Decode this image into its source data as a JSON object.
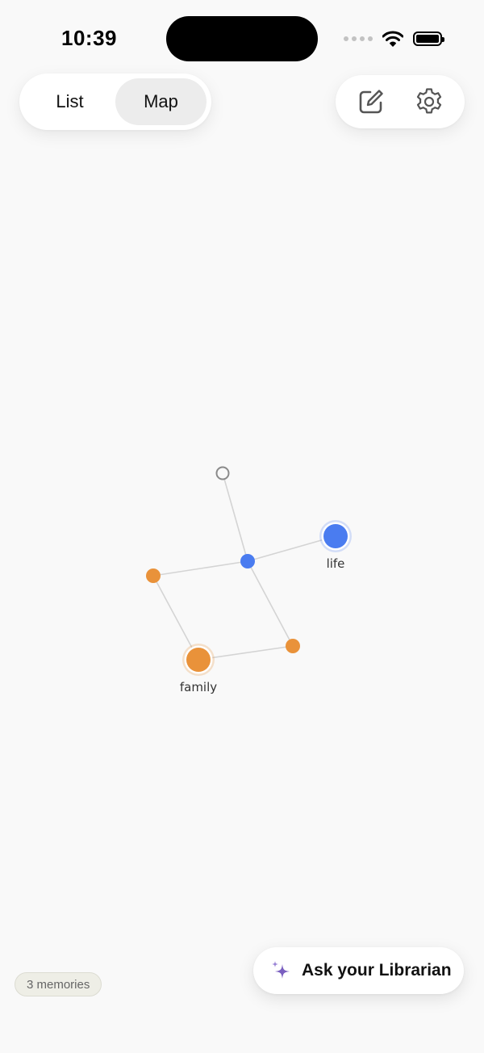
{
  "status_bar": {
    "time": "10:39"
  },
  "view_switcher": {
    "list_label": "List",
    "map_label": "Map",
    "selected": "Map"
  },
  "toolbar": {
    "compose_icon": "square-pencil-icon",
    "settings_icon": "gear-icon"
  },
  "graph": {
    "nodes": [
      {
        "id": "hollow",
        "label": "",
        "kind": "hollow"
      },
      {
        "id": "hub",
        "label": "",
        "kind": "small-blue"
      },
      {
        "id": "life",
        "label": "life",
        "kind": "tag-blue"
      },
      {
        "id": "orange-left",
        "label": "",
        "kind": "small-orange"
      },
      {
        "id": "orange-right",
        "label": "",
        "kind": "small-orange"
      },
      {
        "id": "family",
        "label": "family",
        "kind": "tag-orange"
      }
    ],
    "edges": [
      [
        "hollow",
        "hub"
      ],
      [
        "hub",
        "life"
      ],
      [
        "hub",
        "orange-left"
      ],
      [
        "hub",
        "orange-right"
      ],
      [
        "orange-left",
        "family"
      ],
      [
        "family",
        "orange-right"
      ]
    ],
    "colors": {
      "blue": "#4a7cf0",
      "orange": "#e9923a",
      "edge": "#d4d4d4",
      "hollow_stroke": "#8a8a8a"
    }
  },
  "footer": {
    "memories_count": "3 memories",
    "ask_label": "Ask your Librarian",
    "ask_icon": "sparkles-icon",
    "accent": "#7a5fc0"
  }
}
